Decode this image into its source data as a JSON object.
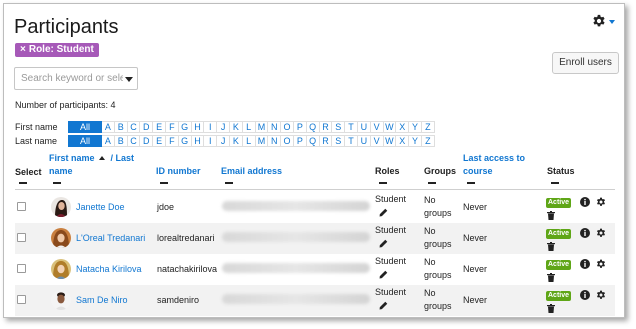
{
  "page": {
    "title": "Participants"
  },
  "filter_badge": {
    "remove": "×",
    "label": "Role: Student"
  },
  "enroll_button": {
    "label": "Enroll users"
  },
  "search": {
    "placeholder": "Search keyword or select f"
  },
  "participants_count": "Number of participants: 4",
  "initials_bar": {
    "first_name_label": "First name",
    "last_name_label": "Last name",
    "all_label": "All",
    "letters": [
      "A",
      "B",
      "C",
      "D",
      "E",
      "F",
      "G",
      "H",
      "I",
      "J",
      "K",
      "L",
      "M",
      "N",
      "O",
      "P",
      "Q",
      "R",
      "S",
      "T",
      "U",
      "V",
      "W",
      "X",
      "Y",
      "Z"
    ]
  },
  "table": {
    "headers": {
      "select": "Select",
      "first_name": "First name",
      "last_name": "/ Last",
      "last_name_cont": "name",
      "id_number": "ID number",
      "email": "Email address",
      "roles": "Roles",
      "groups": "Groups",
      "last_access": "Last access to",
      "last_access_cont": "course",
      "status": "Status"
    },
    "rows": [
      {
        "name": "Janette Doe",
        "id": "jdoe",
        "role": "Student",
        "groups_1": "No",
        "groups_2": "groups",
        "last_access": "Never",
        "status": "Active"
      },
      {
        "name": "L'Oreal Tredanari",
        "id": "lorealtredanari",
        "role": "Student",
        "groups_1": "No",
        "groups_2": "groups",
        "last_access": "Never",
        "status": "Active"
      },
      {
        "name": "Natacha Kirilova",
        "id": "natachakirilova",
        "role": "Student",
        "groups_1": "No",
        "groups_2": "groups",
        "last_access": "Never",
        "status": "Active"
      },
      {
        "name": "Sam De Niro",
        "id": "samdeniro",
        "role": "Student",
        "groups_1": "No",
        "groups_2": "groups",
        "last_access": "Never",
        "status": "Active"
      }
    ]
  },
  "colors": {
    "link": "#1177d1",
    "badge": "#a659b8",
    "active": "#5fa617"
  },
  "icons": [
    "gear-icon",
    "caret-down-icon",
    "sort-ascending-icon",
    "pencil-icon",
    "info-icon",
    "cog-icon",
    "trash-icon"
  ]
}
